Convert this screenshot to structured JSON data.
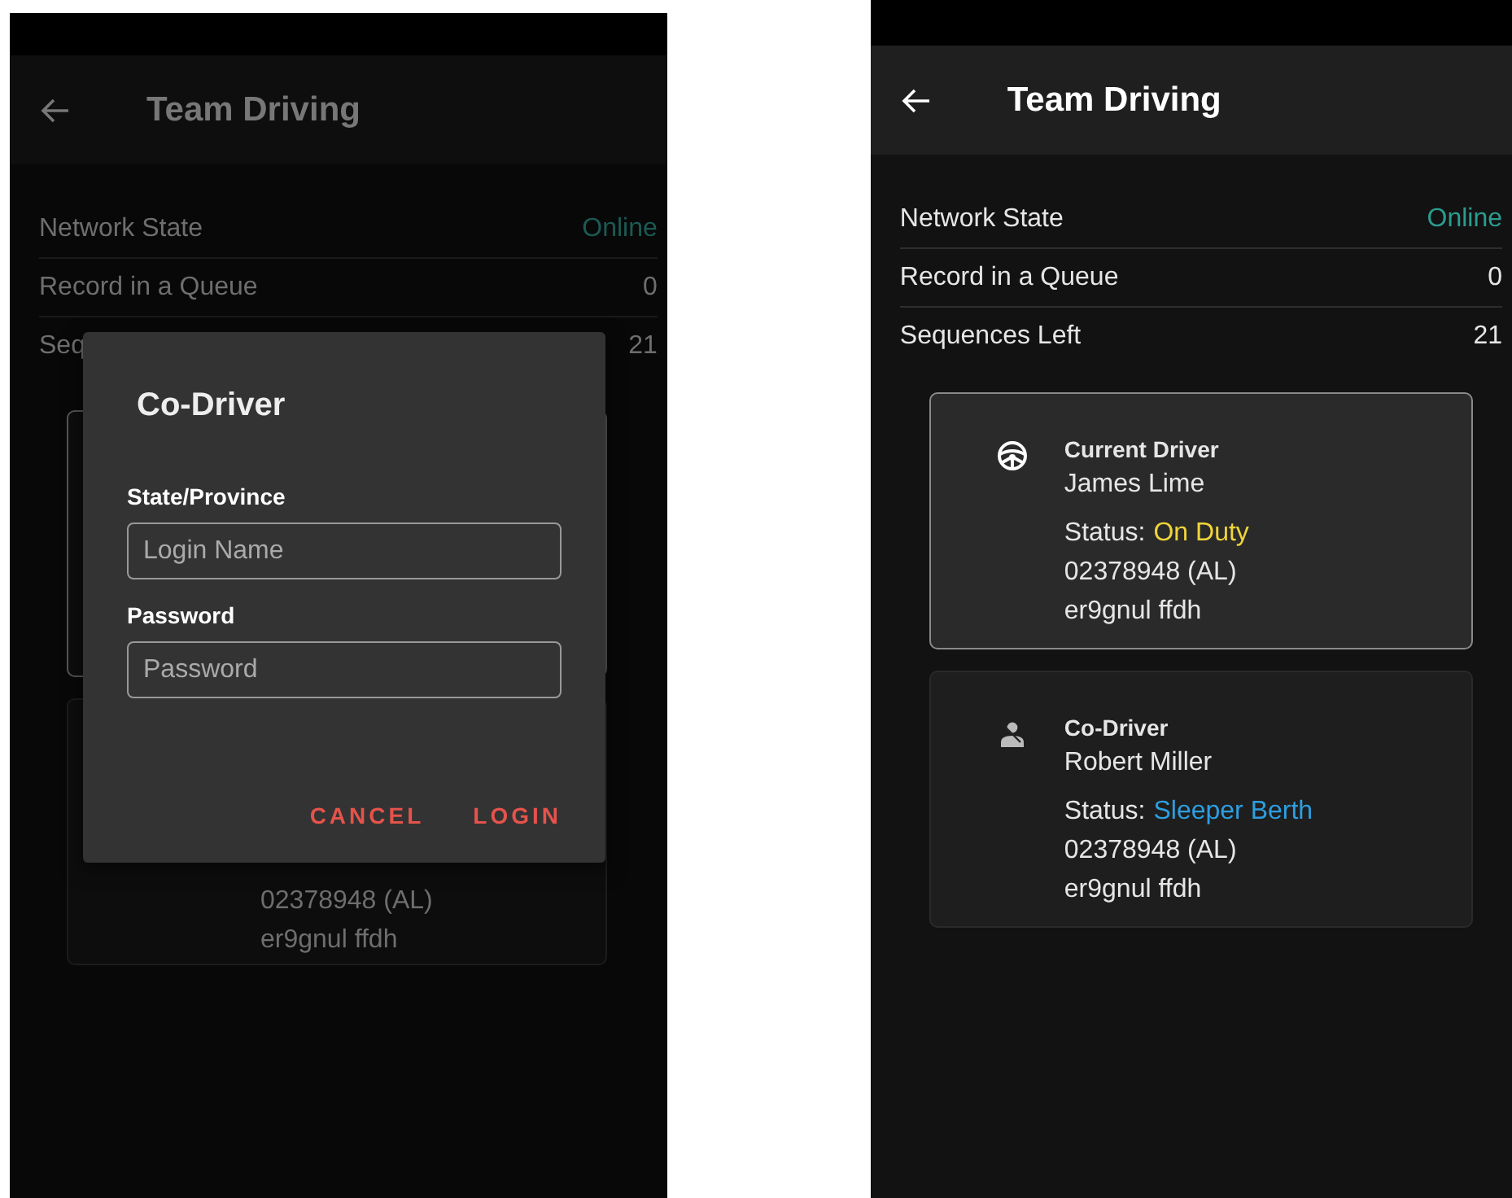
{
  "screens": [
    {
      "header": {
        "title": "Team Driving"
      },
      "info_rows": [
        {
          "label": "Network State",
          "value": "Online",
          "color": "#1b5a53"
        },
        {
          "label": "Record in a Queue",
          "value": "0"
        },
        {
          "label": "Seq",
          "value": "21"
        }
      ],
      "driver_cards": [
        {
          "selected": true
        },
        {
          "selected": false,
          "license": "02378948 (AL)",
          "code": "er9gnul ffdh"
        }
      ],
      "dialog": {
        "title": "Co-Driver",
        "fields": [
          {
            "label": "State/Province",
            "placeholder": "Login Name"
          },
          {
            "label": "Password",
            "placeholder": "Password"
          }
        ],
        "buttons": [
          "CANCEL",
          "LOGIN"
        ]
      }
    },
    {
      "header": {
        "title": "Team Driving"
      },
      "info_rows": [
        {
          "label": "Network State",
          "value": "Online",
          "color": "#2a9d8f"
        },
        {
          "label": "Record in a Queue",
          "value": "0"
        },
        {
          "label": "Sequences Left",
          "value": "21"
        }
      ],
      "driver_cards": [
        {
          "selected": true,
          "kind": "steering",
          "role": "Current Driver",
          "name": "James Lime",
          "status": {
            "label": "Status:",
            "value": "On Duty",
            "color": "#f0d43a"
          },
          "license": "02378948 (AL)",
          "code": "er9gnul ffdh"
        },
        {
          "selected": false,
          "kind": "seat",
          "role": "Co-Driver",
          "name": "Robert Miller",
          "status": {
            "label": "Status:",
            "value": "Sleeper Berth",
            "color": "#2d9ee0"
          },
          "license": "02378948 (AL)",
          "code": "er9gnul ffdh"
        }
      ]
    }
  ]
}
